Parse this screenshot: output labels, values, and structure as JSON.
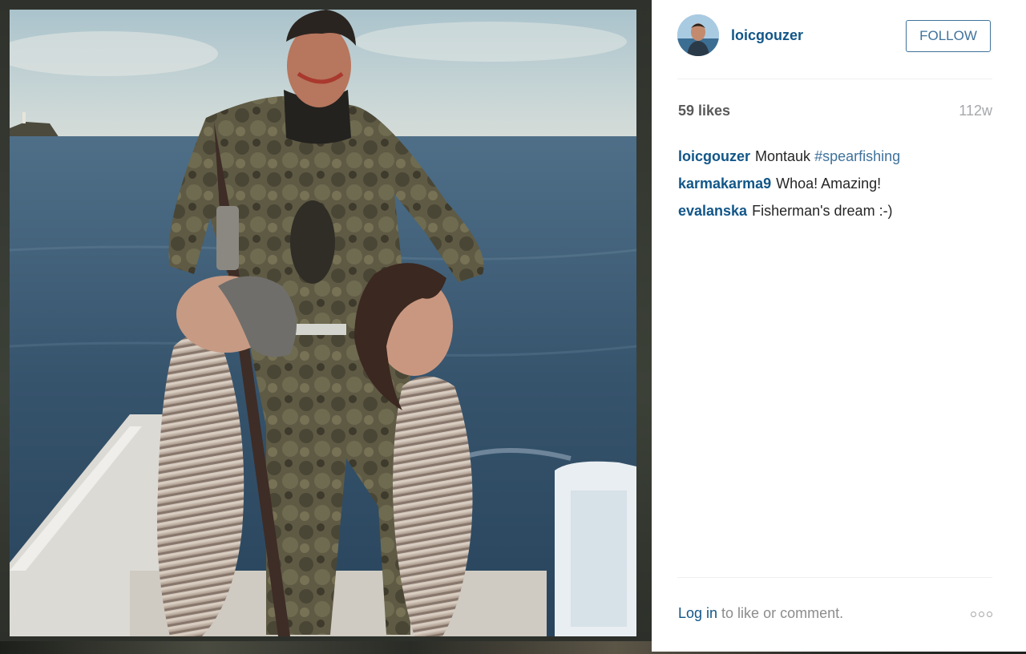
{
  "post": {
    "author": {
      "username": "loicgouzer",
      "follow_label": "FOLLOW"
    },
    "likes_label": "59 likes",
    "age": "112w",
    "comments": [
      {
        "author": "loicgouzer",
        "text": "Montauk ",
        "hashtag": "#spearfishing"
      },
      {
        "author": "karmakarma9",
        "text": "Whoa! Amazing!",
        "hashtag": ""
      },
      {
        "author": "evalanska",
        "text": "Fisherman's dream :-)",
        "hashtag": ""
      }
    ],
    "footer": {
      "login_label": "Log in",
      "rest_label": " to like or comment."
    }
  },
  "colors": {
    "link": "#125688",
    "button": "#3f729b",
    "muted": "#a5a7aa"
  },
  "icons": {
    "more": "more-options-icon"
  }
}
